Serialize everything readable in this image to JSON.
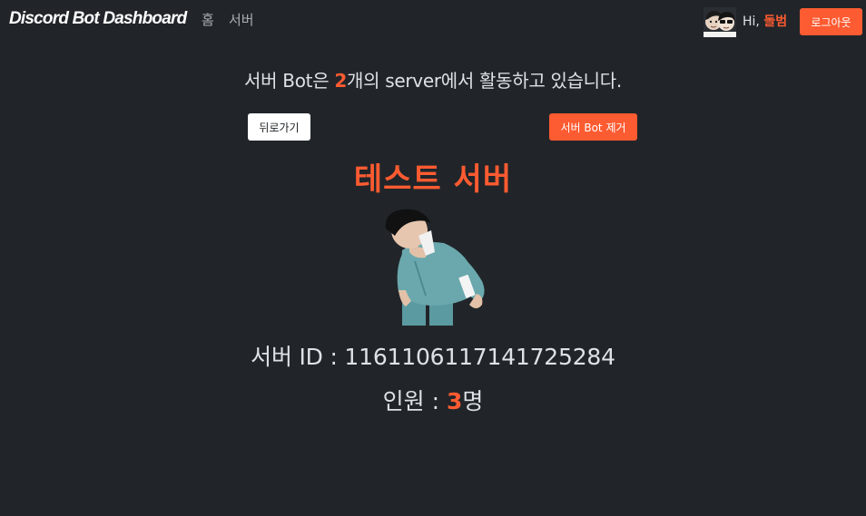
{
  "navbar": {
    "brand": "Discord Bot Dashboard",
    "links": {
      "home": "홈",
      "server": "서버"
    },
    "greeting_prefix": "Hi, ",
    "username": "돌범",
    "logout_label": "로그아웃"
  },
  "summary": {
    "prefix": "서버 Bot은 ",
    "count": "2",
    "suffix": "개의 server에서 활동하고 있습니다."
  },
  "actions": {
    "back_label": "뒤로가기",
    "remove_label": "서버 Bot 제거"
  },
  "server": {
    "name": "테스트 서버",
    "id_line": "서버 ID : 1161106117141725284",
    "members_prefix": "인원 : ",
    "members_count": "3",
    "members_suffix": "명"
  },
  "colors": {
    "background": "#212529",
    "accent": "#fd5b31",
    "text": "#dee2e6",
    "muted": "#a9adb2"
  }
}
